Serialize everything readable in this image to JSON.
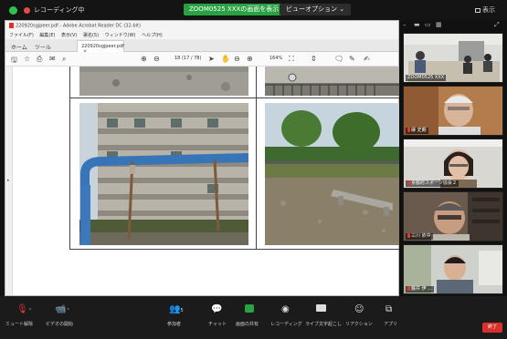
{
  "topbar": {
    "recording_label": "レコーディング中",
    "share_banner": "ZOOM0525 XXXの画面を表示しています",
    "view_options": "ビューオプション ⌄",
    "right_label": "表示"
  },
  "acrobat": {
    "window_title": "220920sgjpeer.pdf - Adobe Acrobat Reader DC (32-bit)",
    "menu": [
      "ファイル(F)",
      "編集(E)",
      "表示(V)",
      "署名(S)",
      "ウィンドウ(W)",
      "ヘルプ(H)"
    ],
    "nav_tabs": [
      "ホーム",
      "ツール"
    ],
    "doc_tab": "220920sgjpeer.pdf",
    "page_indicator": "18 (17 / 78)",
    "zoom": "164%"
  },
  "document": {
    "page_number": ""
  },
  "gallery": {
    "participants": [
      {
        "name": "ZOOM0525 XXX"
      },
      {
        "name": "縁 史朗"
      },
      {
        "name": "京都府スポーツ協会２"
      },
      {
        "name": "三川 依中"
      },
      {
        "name": "藤井 伊 ..."
      }
    ]
  },
  "controls": {
    "mute": "ミュート解除",
    "video": "ビデオの開始",
    "participants": "参加者",
    "participants_count": "5",
    "chat": "チャット",
    "share": "画面の共有",
    "record": "レコーディング",
    "caption": "ライブ文字起こし",
    "reactions": "リアクション",
    "apps": "アプリ",
    "end": "終了"
  },
  "colors": {
    "share_green": "#2aa243",
    "end_red": "#d9302c",
    "recording_red": "#e84a4a"
  }
}
